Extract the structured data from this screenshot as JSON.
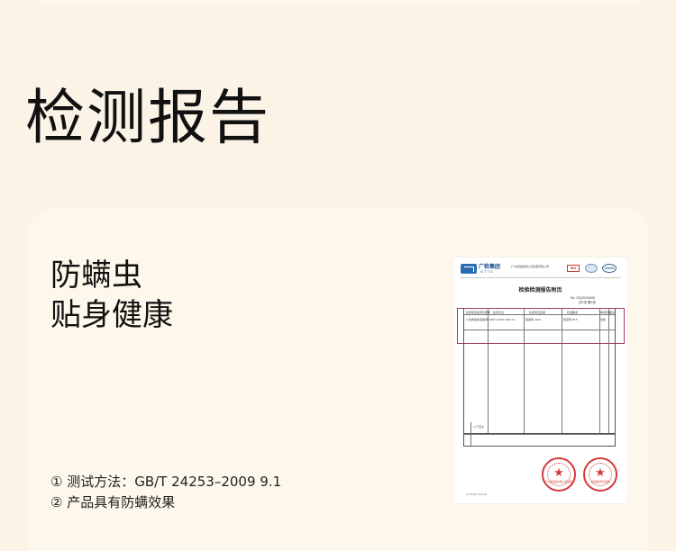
{
  "page": {
    "title": "检测报告"
  },
  "main": {
    "headline_line1": "防螨虫",
    "headline_line2": "贴身健康",
    "note1": "① 测试方法：GB/T 24253–2009 9.1",
    "note2": "② 产品具有防螨效果"
  },
  "report": {
    "brand_name": "广检集团",
    "brand_sub": "GTTC",
    "issuer": "广州检验检测认证集团有限公司",
    "cma_label": "MA",
    "cnas_label": "CNAS",
    "title": "检验检测报告附页",
    "report_no": "No. 22Q3C00490",
    "page_no": "共2页 第2页",
    "row1_cols": [
      "检测项目名称及要求",
      "检测方法",
      "检测值及结果",
      "标准要求",
      "单项判定",
      "备注"
    ],
    "row2_cols": [
      "1.防螨性能(驱避率)",
      "GB/T 24253-2009 9.1",
      "驱避率 ≥60%",
      "驱避率 95.5",
      "合格",
      ""
    ],
    "bottom_label": "以下空白",
    "footer_left": "GTTC-QP-7.8-01-01",
    "stamp1_text": "广州检验检测认证集团",
    "stamp2_text": "检验检测专用章"
  },
  "colors": {
    "background": "#fbf3e6",
    "card": "#fdf7ec",
    "highlight": "#a53a6a",
    "stamp": "#d43a3a"
  }
}
